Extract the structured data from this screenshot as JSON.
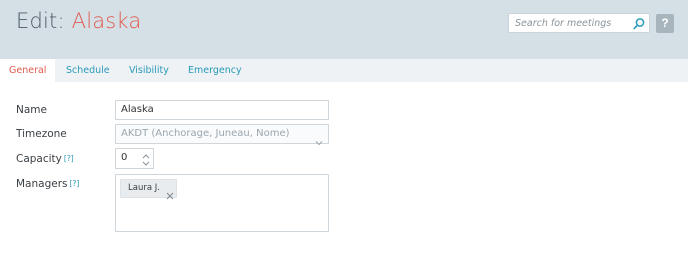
{
  "header": {
    "title_prefix": "Edit: ",
    "title_name": "Alaska",
    "search_placeholder": "Search for meetings",
    "help_label": "?"
  },
  "tabs": [
    {
      "label": "General",
      "active": true
    },
    {
      "label": "Schedule",
      "active": false
    },
    {
      "label": "Visibility",
      "active": false
    },
    {
      "label": "Emergency",
      "active": false
    }
  ],
  "form": {
    "name": {
      "label": "Name",
      "value": "Alaska"
    },
    "timezone": {
      "label": "Timezone",
      "value": "AKDT (Anchorage, Juneau, Nome)"
    },
    "capacity": {
      "label": "Capacity",
      "help": "[?]",
      "value": "0"
    },
    "managers": {
      "label": "Managers",
      "help": "[?]",
      "tags": [
        "Laura J."
      ]
    }
  },
  "colors": {
    "accent": "#e05a4e",
    "link": "#2a9ab8",
    "header_bg": "#d5dfe6"
  }
}
